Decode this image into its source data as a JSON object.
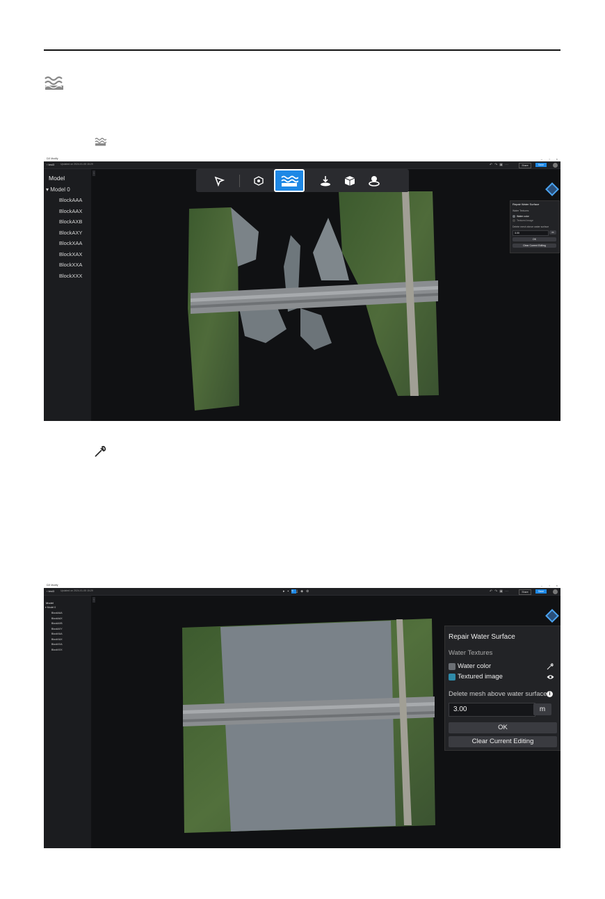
{
  "screen1": {
    "app_title": "DJI Modify",
    "project_name": "test3",
    "updated_text": "Updated on 2024-01-05 15:29",
    "share_label": "Share",
    "save_label": "Save",
    "sidebar_title": "Model",
    "model_name": "Model 0",
    "blocks": [
      "BlockAAA",
      "BlockAAX",
      "BlockAXB",
      "BlockAXY",
      "BlockXAA",
      "BlockXAX",
      "BlockXXA",
      "BlockXXX"
    ],
    "tools": [
      "select-tool-icon",
      "mesh-tool-icon",
      "water-surface-tool-icon",
      "flatten-tool-icon",
      "texture-tool-icon",
      "repair-tool-icon"
    ],
    "active_tool": "water-surface-tool-icon",
    "panel": {
      "title": "Repair Water Surface",
      "section_label": "Water Textures",
      "water_color_label": "Water color",
      "textured_image_label": "Textured image",
      "delete_label": "Delete mesh above water surface",
      "height_value": "3.00",
      "unit": "m",
      "ok_label": "OK",
      "clear_label": "Clear Current Editing"
    }
  },
  "screen2": {
    "app_title": "DJI Modify",
    "project_name": "test3",
    "updated_text": "Updated on 2024-01-05 15:29",
    "share_label": "Share",
    "save_label": "Save",
    "sidebar_title": "Model",
    "model_name": "Model 0",
    "blocks": [
      "BlockAAA",
      "BlockAAX",
      "BlockAXB",
      "BlockAXY",
      "BlockXAA",
      "BlockXAX",
      "BlockXXA",
      "BlockXXX"
    ],
    "panel": {
      "title": "Repair Water Surface",
      "section_label": "Water Textures",
      "water_color_label": "Water color",
      "textured_image_label": "Textured image",
      "delete_label": "Delete mesh above water surface",
      "height_value": "3.00",
      "unit": "m",
      "ok_label": "OK",
      "clear_label": "Clear Current Editing",
      "water_swatch_color": "#6b6f74",
      "textured_swatch_color": "#2f8aa8"
    }
  },
  "colors": {
    "accent": "#1e88e5",
    "ui_dark": "#1b1c1f",
    "water_surface": "#7a8289"
  }
}
